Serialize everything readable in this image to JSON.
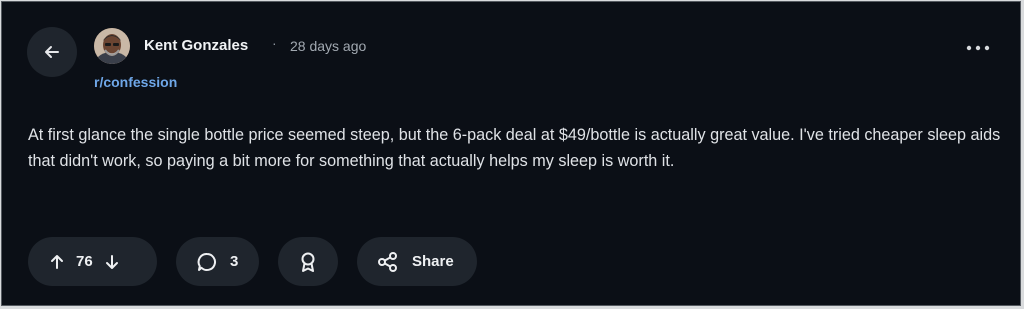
{
  "post": {
    "author": "Kent Gonzales",
    "separator": "·",
    "time_ago": "28 days ago",
    "community": "r/confession",
    "body": "At first glance the single bottle price seemed steep, but the 6-pack deal at $49/bottle is actually great value. I've tried cheaper sleep aids that didn't work, so paying a bit more for something that actually helps my sleep is worth it."
  },
  "actions": {
    "vote_count": "76",
    "comment_count": "3",
    "share_label": "Share"
  },
  "icons": {
    "back": "arrow-left-icon",
    "more": "more-horizontal-icon",
    "upvote": "arrow-up-icon",
    "downvote": "arrow-down-icon",
    "comment": "comment-bubble-icon",
    "award": "award-ribbon-icon",
    "share": "share-nodes-icon"
  },
  "colors": {
    "background": "#0b0f16",
    "pill": "#1f252d",
    "link": "#6fa7e8",
    "text": "#dfe2e6"
  }
}
